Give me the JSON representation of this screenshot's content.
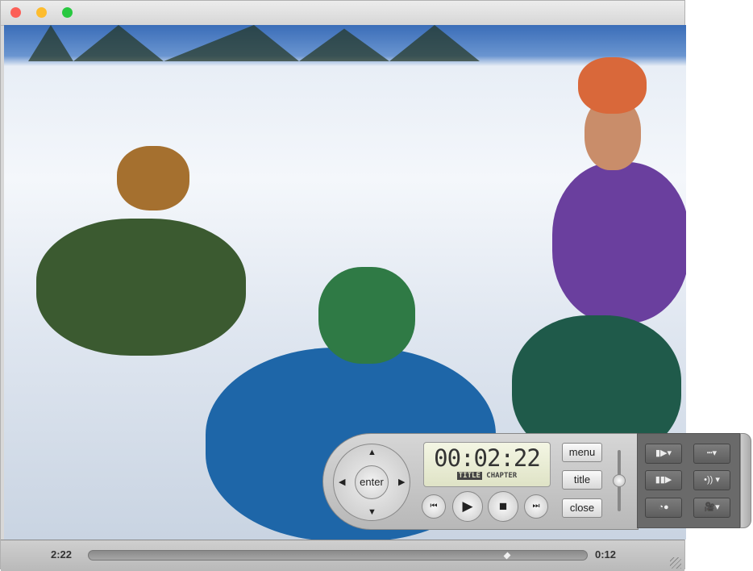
{
  "window": {
    "traffic_lights": {
      "close": "#fc5f57",
      "minimize": "#fdbc2e",
      "zoom": "#28c840"
    }
  },
  "player": {
    "elapsed": "2:22",
    "remaining": "0:12",
    "progress_fraction": 0.84
  },
  "controller": {
    "timecode": "00:02:22",
    "lcd_title": "TITLE",
    "lcd_chapter": "CHAPTER",
    "enter_label": "enter",
    "menu_label": "menu",
    "title_label": "title",
    "close_label": "close",
    "volume_fraction": 0.5,
    "transport": [
      "previous-chapter-icon",
      "play-icon",
      "stop-icon",
      "next-chapter-icon"
    ],
    "side_icons": [
      "slow-motion-icon",
      "subtitles-icon",
      "step-frame-icon",
      "audio-track-icon",
      "eject-icon",
      "camera-angle-icon"
    ]
  }
}
